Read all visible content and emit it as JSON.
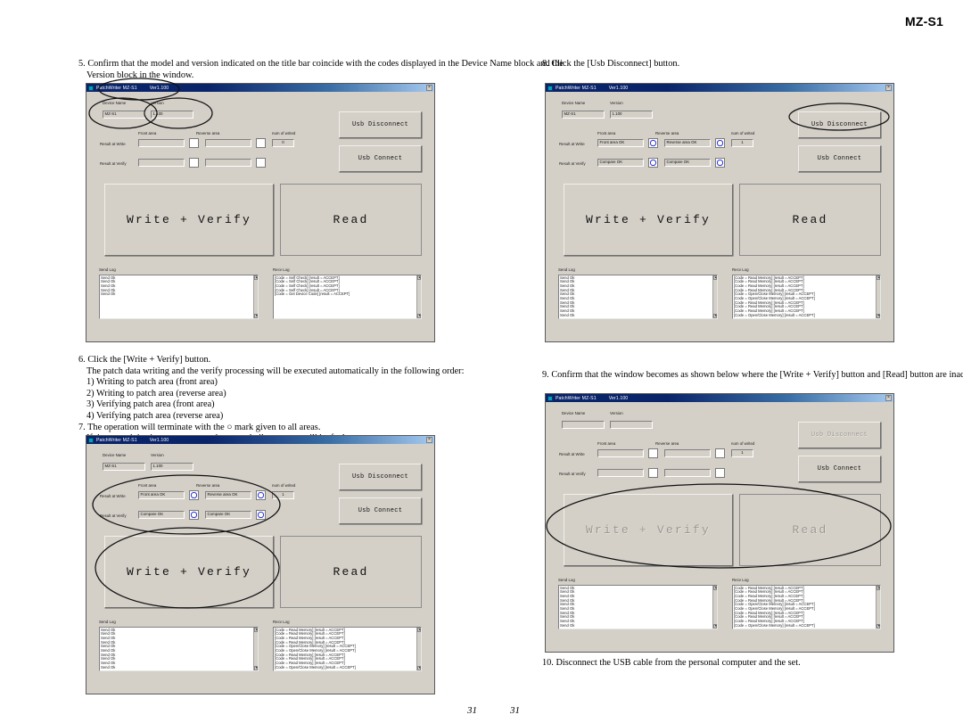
{
  "document": {
    "model_header": "MZ-S1",
    "page_number_left": "31",
    "page_number_right": "31"
  },
  "steps": {
    "step5": {
      "number": "5.",
      "line1": "Confirm that the model and version indicated on the title bar coincide with the codes displayed in the Device Name block and the",
      "line2": "Version block in the window."
    },
    "step6": {
      "number": "6.",
      "line1": "Click the [Write + Verify] button.",
      "line2": "The patch data writing and the verify processing will be executed automatically in the following order:",
      "sub1": "1) Writing to patch area (front area)",
      "sub2": "2) Writing to patch area (reverse area)",
      "sub3": "3) Verifying patch area (front area)",
      "sub4": "4) Verifying patch area (reverse area)"
    },
    "step7": {
      "number": "7.",
      "line1": "The operation will terminate with the ○ mark given to all areas.",
      "line2": "If the × mark is given to any area, the nonvolatile memory will be faulty."
    },
    "step8": {
      "number": "8.",
      "line1": "Click the [Usb Disconnect] button."
    },
    "step9": {
      "number": "9.",
      "line1": "Confirm that the window becomes as shown below where the [Write + Verify] button and [Read] button are inactive."
    },
    "step10": {
      "number": "10.",
      "line1": "Disconnect the USB cable from the personal computer and the set."
    }
  },
  "app": {
    "title": "PatchWriter MZ-S1",
    "title_version": "Ver1.100",
    "close_glyph": "×",
    "labels": {
      "device_name": "Device Name",
      "version": "Version",
      "front_area": "Front area",
      "reverse_area": "Reverse area",
      "num_of_writed": "num of writed",
      "result_at_write": "Result at Write",
      "result_at_verify": "Result at Verify",
      "send_log": "Send Log",
      "recv_log": "Recv Log"
    },
    "buttons": {
      "usb_disconnect": "Usb Disconnect",
      "usb_connect": "Usb Connect",
      "write_verify": "Write + Verify",
      "read": "Read"
    },
    "scroll": {
      "up": "▲",
      "down": "▼"
    }
  },
  "windows": {
    "w1": {
      "device_name": "MZ-S1",
      "version": "1.100",
      "write_front": "",
      "write_reverse": "",
      "verify_front": "",
      "verify_reverse": "",
      "num_writed": "0",
      "marks": {
        "write_front": false,
        "write_reverse": false,
        "verify_front": false,
        "verify_reverse": false
      },
      "send_log": [
        "Send Ok",
        "Send Ok",
        "Send Ok",
        "Send Ok",
        "Send Ok"
      ],
      "recv_log": [
        "[Code = Self Check]  [result = ACCEPT]",
        "[Code = Self Check]  [result = ACCEPT]",
        "[Code = Self Check]  [result = ACCEPT]",
        "[Code = Self Check]  [result = ACCEPT]",
        "[Code = Get Device Code]  [result = ACCEPT]"
      ]
    },
    "w2": {
      "device_name": "MZ-S1",
      "version": "1.100",
      "write_front": "Front area OK",
      "write_reverse": "Reverse area OK",
      "verify_front": "Compare OK",
      "verify_reverse": "Compare OK",
      "num_writed": "1",
      "marks": {
        "write_front": true,
        "write_reverse": true,
        "verify_front": true,
        "verify_reverse": true
      },
      "send_log": [
        "Send Ok",
        "Send Ok",
        "Send Ok",
        "Send Ok",
        "Send Ok",
        "Send Ok",
        "Send Ok",
        "Send Ok",
        "Send Ok",
        "Send Ok"
      ],
      "recv_log": [
        "[Code = Read Memory]  [result = ACCEPT]",
        "[Code = Read Memory]  [result = ACCEPT]",
        "[Code = Read Memory]  [result = ACCEPT]",
        "[Code = Read Memory]  [result = ACCEPT]",
        "[Code = Open/Close Memory]  [result = ACCEPT]",
        "[Code = Open/Close Memory]  [result = ACCEPT]",
        "[Code = Read Memory]  [result = ACCEPT]",
        "[Code = Read Memory]  [result = ACCEPT]",
        "[Code = Read Memory]  [result = ACCEPT]",
        "[Code = Open/Close Memory]  [result = ACCEPT]"
      ]
    },
    "w3": {
      "device_name": "MZ-S1",
      "version": "1.100",
      "write_front": "Front area OK",
      "write_reverse": "Reverse area OK",
      "verify_front": "Compare OK",
      "verify_reverse": "Compare OK",
      "num_writed": "1",
      "marks": {
        "write_front": true,
        "write_reverse": true,
        "verify_front": true,
        "verify_reverse": true
      },
      "send_log": [
        "Send Ok",
        "Send Ok",
        "Send Ok",
        "Send Ok",
        "Send Ok",
        "Send Ok",
        "Send Ok",
        "Send Ok",
        "Send Ok",
        "Send Ok"
      ],
      "recv_log": [
        "[Code = Read Memory]  [result = ACCEPT]",
        "[Code = Read Memory]  [result = ACCEPT]",
        "[Code = Read Memory]  [result = ACCEPT]",
        "[Code = Read Memory]  [result = ACCEPT]",
        "[Code = Open/Close Memory]  [result = ACCEPT]",
        "[Code = Open/Close Memory]  [result = ACCEPT]",
        "[Code = Read Memory]  [result = ACCEPT]",
        "[Code = Read Memory]  [result = ACCEPT]",
        "[Code = Read Memory]  [result = ACCEPT]",
        "[Code = Open/Close Memory]  [result = ACCEPT]"
      ]
    },
    "w4": {
      "device_name": "",
      "version": "",
      "write_front": "",
      "write_reverse": "",
      "verify_front": "",
      "verify_reverse": "",
      "num_writed": "1",
      "marks": {
        "write_front": false,
        "write_reverse": false,
        "verify_front": false,
        "verify_reverse": false
      },
      "send_log": [
        "Send Ok",
        "Send Ok",
        "Send Ok",
        "Send Ok",
        "Send Ok",
        "Send Ok",
        "Send Ok",
        "Send Ok",
        "Send Ok",
        "Send Ok"
      ],
      "recv_log": [
        "[Code = Read Memory]  [result = ACCEPT]",
        "[Code = Read Memory]  [result = ACCEPT]",
        "[Code = Read Memory]  [result = ACCEPT]",
        "[Code = Read Memory]  [result = ACCEPT]",
        "[Code = Open/Close Memory]  [result = ACCEPT]",
        "[Code = Open/Close Memory]  [result = ACCEPT]",
        "[Code = Read Memory]  [result = ACCEPT]",
        "[Code = Read Memory]  [result = ACCEPT]",
        "[Code = Read Memory]  [result = ACCEPT]",
        "[Code = Open/Close Memory]  [result = ACCEPT]"
      ]
    }
  },
  "colors": {
    "window_face": "#d4d0c8",
    "titlebar_start": "#0a246a",
    "titlebar_end": "#a6caf0",
    "ok_ring": "#2b35d6",
    "annotation": "#111111"
  }
}
